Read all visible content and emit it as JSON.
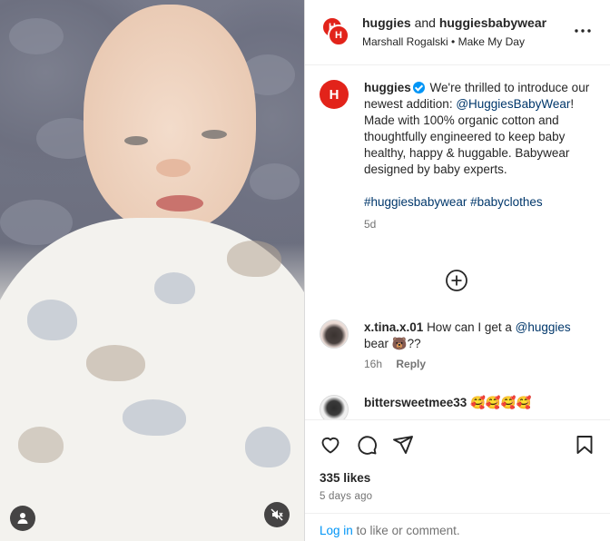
{
  "post": {
    "owner": "huggies",
    "collab_joiner": "and",
    "collaborator": "huggiesbabywear",
    "audio_artist": "Marshall Rogalski",
    "audio_sep": "•",
    "audio_title": "Make My Day",
    "avatar_letter": "H"
  },
  "caption": {
    "username": "huggies",
    "text_1": "We're thrilled to introduce our newest addition: ",
    "mention": "@HuggiesBabyWear",
    "text_2": "! Made with 100% organic cotton and thoughtfully engineered to keep baby healthy, happy & huggable. Babywear designed by baby experts.",
    "hashtag_1": "#huggiesbabywear",
    "hashtag_2": "#babyclothes",
    "time": "5d"
  },
  "comments": [
    {
      "username": "x.tina.x.01",
      "text_1": "How can I get a ",
      "mention": "@huggies",
      "text_2": " bear 🐻??",
      "time": "16h",
      "reply_label": "Reply"
    },
    {
      "username": "bittersweetmee33",
      "text": "🥰🥰🥰🥰"
    }
  ],
  "footer": {
    "likes": "335 likes",
    "ago": "5 days ago",
    "login_label": "Log in",
    "login_suffix": " to like or comment."
  },
  "colors": {
    "brand": "#e2231a",
    "link": "#00376b",
    "verified": "#0095f6"
  },
  "icons": [
    "more-icon",
    "add-comment-icon",
    "heart-icon",
    "comment-icon",
    "share-icon",
    "bookmark-icon",
    "user-tag-icon",
    "mute-icon"
  ]
}
